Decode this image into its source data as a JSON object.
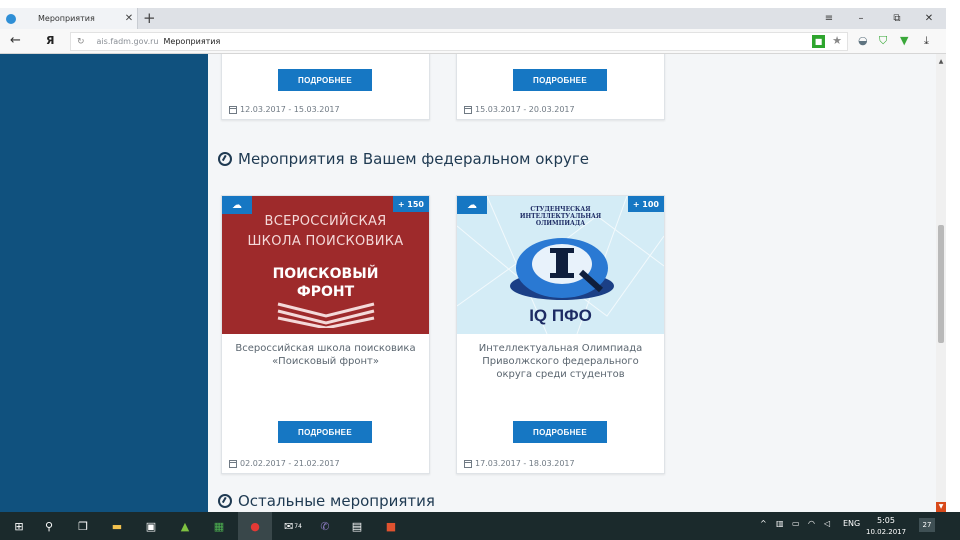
{
  "browser": {
    "tab_title": "Мероприятия",
    "tab_close": "✕",
    "new_tab": "+",
    "controls": {
      "menu": "≡",
      "minimize": "–",
      "restore": "⧉",
      "close": "✕"
    },
    "back_glyph": "←",
    "yandex_glyph": "Я",
    "url_domain": "ais.fadm.gov.ru",
    "url_title": "Мероприятия"
  },
  "colors": {
    "sidebar": "#10517e",
    "accent": "#1677c3",
    "content_bg": "#f4f6f8",
    "heading": "#1f3a52"
  },
  "top_cards": [
    {
      "button_label": "ПОДРОБНЕЕ",
      "date": "12.03.2017 - 15.03.2017"
    },
    {
      "button_label": "ПОДРОБНЕЕ",
      "date": "15.03.2017 - 20.03.2017"
    }
  ],
  "section_federal": {
    "heading": "Мероприятия в Вашем федеральном округе"
  },
  "federal_cards": [
    {
      "points": "+ 150",
      "image_lines": [
        "ВСЕРОССИЙСКАЯ",
        "ШКОЛА ПОИСКОВИКА",
        "ПОИСКОВЫЙ",
        "ФРОНТ"
      ],
      "title": "Всероссийская школа поисковика «Поисковый фронт»",
      "button_label": "ПОДРОБНЕЕ",
      "date": "02.02.2017 - 21.02.2017"
    },
    {
      "points": "+ 100",
      "image_lines": [
        "СТУДЕНЧЕСКАЯ",
        "ИНТЕЛЛЕКТУАЛЬНАЯ",
        "ОЛИМПИАДА",
        "IQ ПФО"
      ],
      "title": "Интеллектуальная Олимпиада Приволжского федерального округа среди студентов",
      "button_label": "ПОДРОБНЕЕ",
      "date": "17.03.2017 - 18.03.2017"
    }
  ],
  "section_other": {
    "heading": "Остальные мероприятия"
  },
  "taskbar": {
    "yandex_badge": "74",
    "lang": "ENG",
    "time": "5:05",
    "date": "10.02.2017",
    "notifications": "27"
  }
}
